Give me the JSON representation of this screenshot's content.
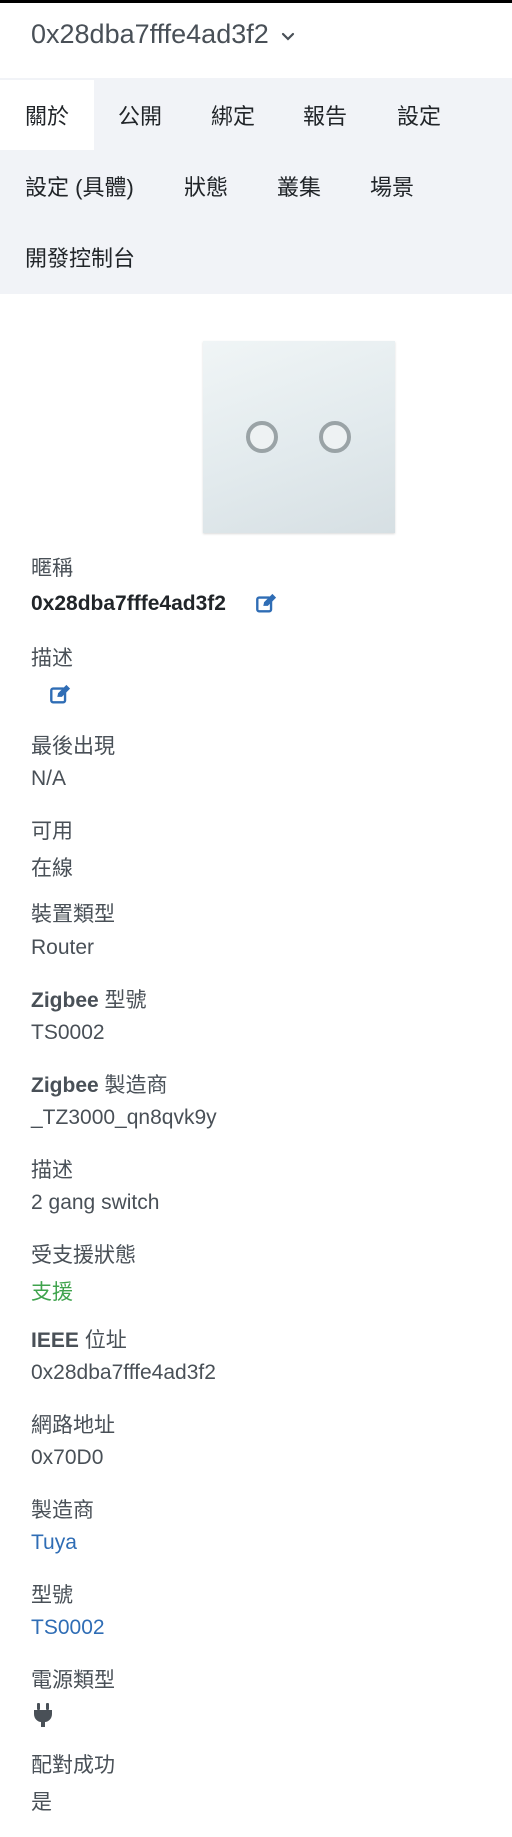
{
  "header": {
    "device_name": "0x28dba7fffe4ad3f2"
  },
  "tabs": [
    {
      "label": "關於",
      "active": true
    },
    {
      "label": "公開"
    },
    {
      "label": "綁定"
    },
    {
      "label": "報告"
    },
    {
      "label": "設定"
    },
    {
      "label": "設定 (具體)"
    },
    {
      "label": "狀態"
    },
    {
      "label": "叢集"
    },
    {
      "label": "場景"
    },
    {
      "label": "開發控制台"
    }
  ],
  "about": {
    "nickname_label": "暱稱",
    "nickname_value": "0x28dba7fffe4ad3f2",
    "description_label": "描述",
    "last_seen_label": "最後出現",
    "last_seen_value": "N/A",
    "availability_label": "可用",
    "availability_value": "在線",
    "device_type_label": "裝置類型",
    "device_type_value": "Router",
    "zigbee_model_label_strong": "Zigbee",
    "zigbee_model_label_rest": " 型號",
    "zigbee_model_value": "TS0002",
    "zigbee_mfr_label_strong": "Zigbee",
    "zigbee_mfr_label_rest": " 製造商",
    "zigbee_mfr_value": "_TZ3000_qn8qvk9y",
    "desc2_label": "描述",
    "desc2_value": "2 gang switch",
    "support_label": "受支援狀態",
    "support_value": "支援",
    "ieee_label_strong": "IEEE",
    "ieee_label_rest": " 位址",
    "ieee_value": "0x28dba7fffe4ad3f2",
    "network_label": "網路地址",
    "network_value": "0x70D0",
    "manufacturer_label": "製造商",
    "manufacturer_value": "Tuya",
    "model_label": "型號",
    "model_value": "TS0002",
    "power_label": "電源類型",
    "power_icon": "plug-icon",
    "interview_label": "配對成功",
    "interview_value": "是"
  },
  "colors": {
    "accent_blue": "#2f6db5",
    "success_green": "#3fa34d",
    "tab_bg": "#f1f3f7"
  }
}
